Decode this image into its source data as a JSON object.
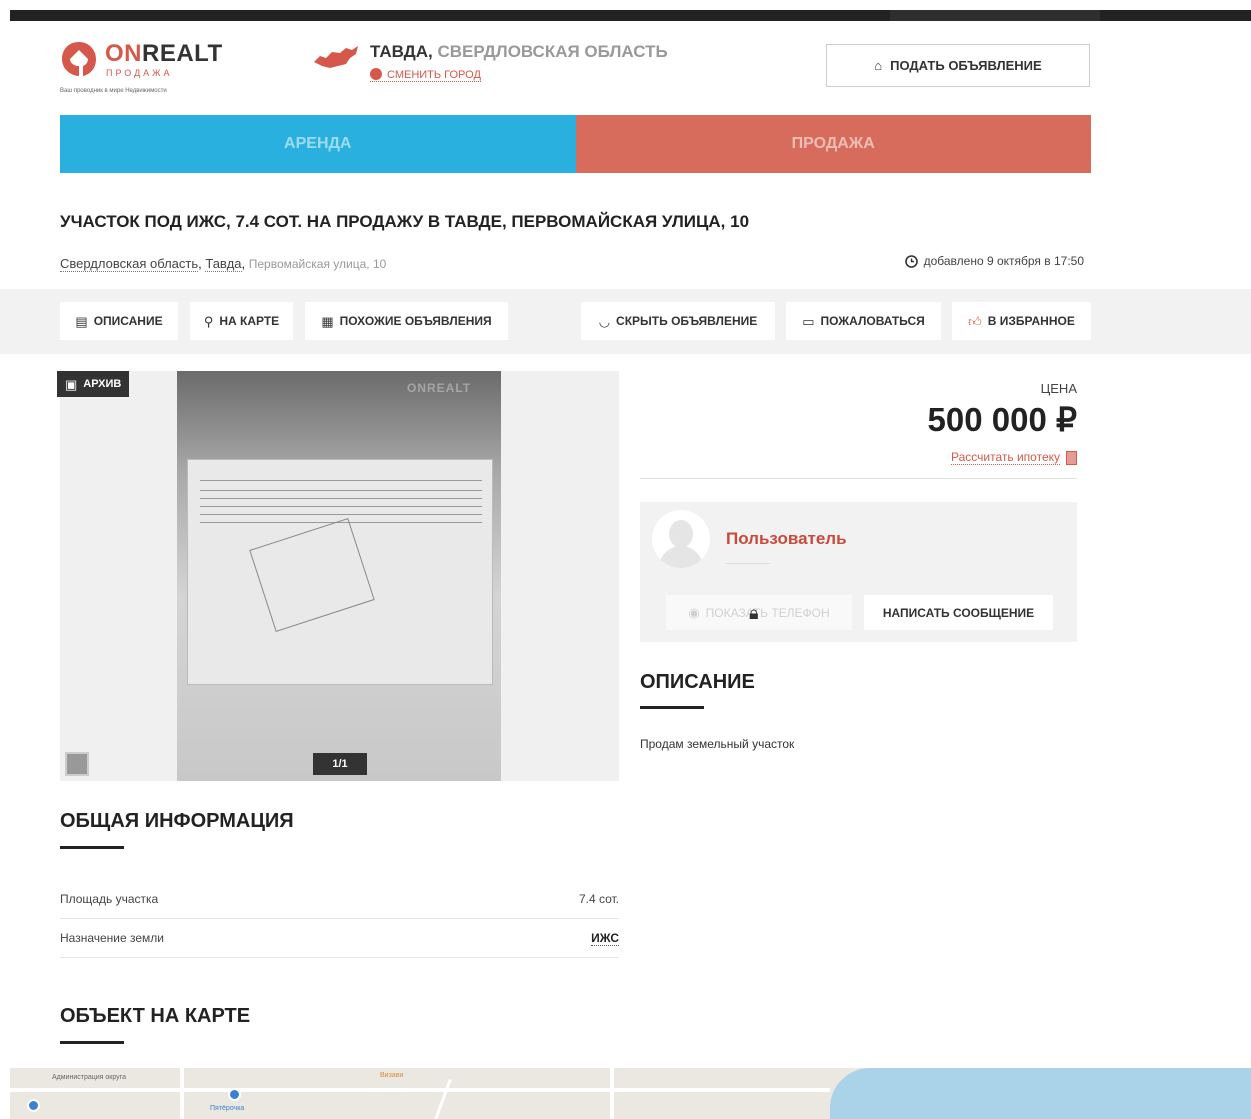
{
  "header": {
    "logo": {
      "word_on": "ON",
      "word_realt": "REALT",
      "sub": "ПРОДАЖА",
      "tagline": "Ваш проводник в мире Недвижимости"
    },
    "city": {
      "name": "ТАВДА,",
      "region": "СВЕРДЛОВСКАЯ ОБЛАСТЬ",
      "change_label": "СМЕНИТЬ ГОРОД"
    },
    "post_button": "ПОДАТЬ ОБЪЯВЛЕНИЕ"
  },
  "tabs": [
    {
      "label": "АРЕНДА"
    },
    {
      "label": "ПРОДАЖА"
    }
  ],
  "listing": {
    "title": "УЧАСТОК ПОД ИЖС, 7.4 СОТ. НА ПРОДАЖУ В ТАВДЕ, ПЕРВОМАЙСКАЯ УЛИЦА, 10",
    "address": {
      "region": "Свердловская область",
      "city": "Тавда",
      "street": "Первомайская улица, 10"
    },
    "added": "добавлено 9 октября в 17:50"
  },
  "actions": [
    {
      "label": "ОПИСАНИЕ",
      "icon": "document-icon"
    },
    {
      "label": "НА КАРТЕ",
      "icon": "map-pin-icon"
    },
    {
      "label": "ПОХОЖИЕ ОБЪЯВЛЕНИЯ",
      "icon": "list-icon"
    },
    {
      "label": "СКРЫТЬ ОБЪЯВЛЕНИЕ",
      "icon": "closed-eye-icon"
    },
    {
      "label": "ПОЖАЛОВАТЬСЯ",
      "icon": "comment-icon"
    },
    {
      "label": "В ИЗБРАННОЕ",
      "icon": "thumbs-up-icon"
    }
  ],
  "gallery": {
    "badge": "АРХИВ",
    "counter": "1/1",
    "watermark": "ONREALT"
  },
  "price": {
    "label": "ЦЕНА",
    "value": "500 000 ₽",
    "mortgage_link": "Рассчитать ипотеку"
  },
  "seller": {
    "name": "Пользователь",
    "phone_button": "ПОКАЗАТЬ ТЕЛЕФОН",
    "message_button": "НАПИСАТЬ СООБЩЕНИЕ"
  },
  "description": {
    "heading": "ОПИСАНИЕ",
    "text": "Продам земельный участок"
  },
  "general_info": {
    "heading": "ОБЩАЯ ИНФОРМАЦИЯ",
    "rows": [
      {
        "key": "Площадь участка",
        "value": "7.4 сот."
      },
      {
        "key": "Назначение земли",
        "value": "ИЖС"
      }
    ]
  },
  "map_section": {
    "heading": "ОБЪЕКТ НА КАРТЕ",
    "labels": [
      "Администрация округа",
      "Пятёрочка",
      "Визави"
    ]
  },
  "colors": {
    "brand_red": "#d5584b",
    "rent_blue": "#29b0de",
    "sale_red": "#d86c5c"
  }
}
